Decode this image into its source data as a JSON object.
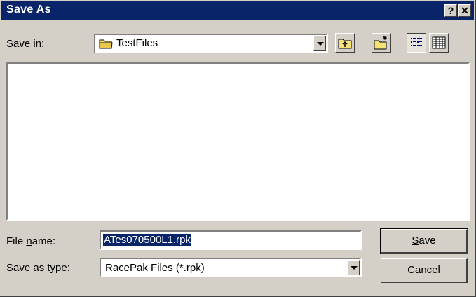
{
  "window": {
    "title": "Save As",
    "help_glyph": "?",
    "close_glyph": "✕"
  },
  "save_in": {
    "label_pre": "Save ",
    "label_accel": "i",
    "label_post": "n:",
    "folder": "TestFiles",
    "folder_icon": "folder-icon"
  },
  "toolbar": {
    "up_icon": "up-one-level-icon",
    "new_folder_icon": "new-folder-icon",
    "list_icon": "list-view-icon",
    "details_icon": "details-view-icon"
  },
  "file_name": {
    "label_pre": "File ",
    "label_accel": "n",
    "label_post": "ame:",
    "value": "ATes070500L1.rpk"
  },
  "save_type": {
    "label_pre": "Save as ",
    "label_accel": "t",
    "label_post": "ype:",
    "value": "RacePak Files (*.rpk)"
  },
  "buttons": {
    "save_accel": "S",
    "save_rest": "ave",
    "cancel": "Cancel"
  }
}
